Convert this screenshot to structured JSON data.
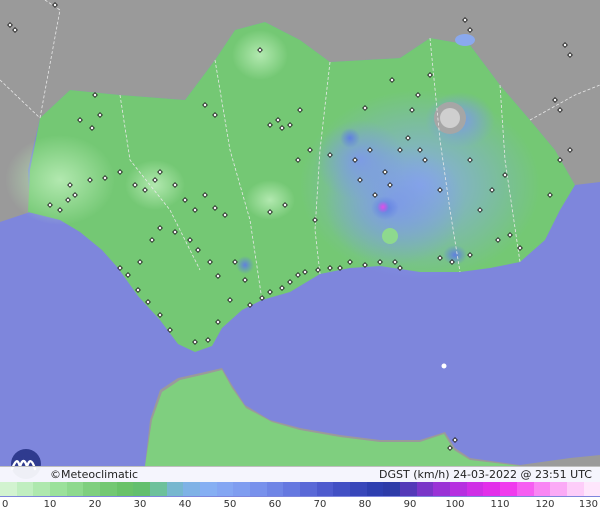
{
  "credit_text": "©Meteoclimatic",
  "variable_label": "DGST (km/h)",
  "timestamp": "24-03-2022 @ 23:51 UTC",
  "colors": {
    "sea": "#7e86dc",
    "neighbor_land": "#9a9a9a",
    "border_line": "#e8e8e8"
  },
  "scale": {
    "min": 0,
    "max": 130,
    "tick_labels": [
      "0",
      "10",
      "20",
      "30",
      "40",
      "50",
      "60",
      "70",
      "80",
      "90",
      "100",
      "110",
      "120",
      "130"
    ],
    "colors": [
      "#d2f3d0",
      "#c0eec0",
      "#aee8ae",
      "#9be19b",
      "#8ed98e",
      "#7fcf7f",
      "#73c873",
      "#69c269",
      "#63bf6e",
      "#6dc19b",
      "#77b7cf",
      "#7fb2e6",
      "#86aff3",
      "#84a6f3",
      "#7f9df0",
      "#7891ec",
      "#6f85e6",
      "#6578e0",
      "#5a69d7",
      "#4e5bce",
      "#4250c4",
      "#3847ba",
      "#2e3fb0",
      "#2d3ba8",
      "#5439b8",
      "#7a36c8",
      "#9a33d6",
      "#b630e0",
      "#cf2fe6",
      "#e22fea",
      "#f03bee",
      "#f65ef2",
      "#f986f4",
      "#fbaaf6",
      "#fdcdf9",
      "#fee6fc"
    ]
  }
}
